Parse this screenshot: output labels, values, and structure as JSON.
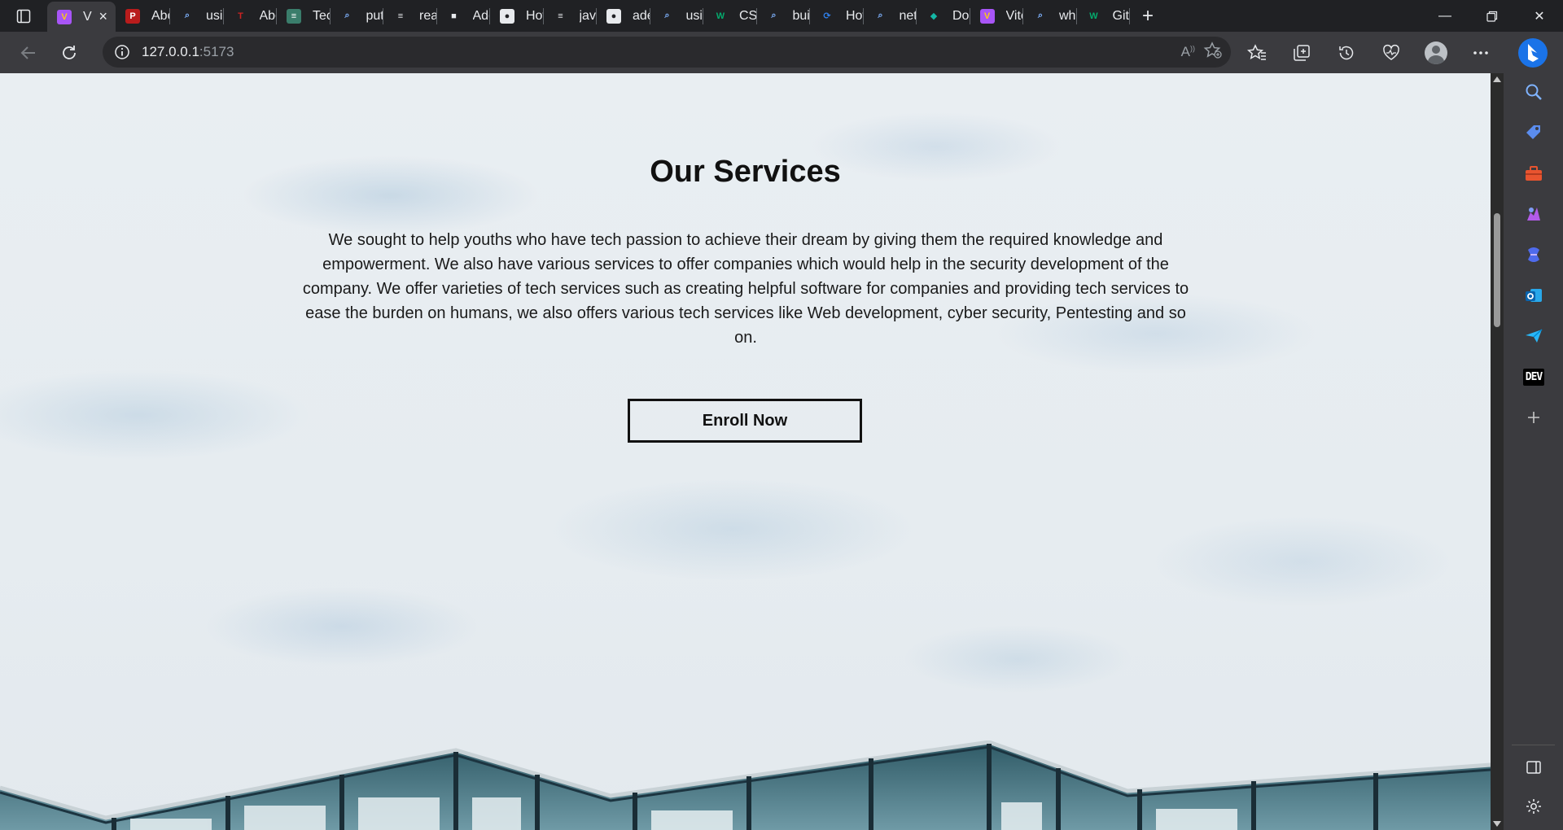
{
  "tabs": [
    {
      "title": "V",
      "favicon": "vite-icon",
      "active": true
    },
    {
      "title": "Abou",
      "favicon": "pdf-icon"
    },
    {
      "title": "using",
      "favicon": "search-icon"
    },
    {
      "title": "Abou",
      "favicon": "tesla-icon"
    },
    {
      "title": "Tech",
      "favicon": "doc-icon"
    },
    {
      "title": "puttir",
      "favicon": "search-icon"
    },
    {
      "title": "react",
      "favicon": "stack-icon"
    },
    {
      "title": "Add",
      "favicon": "video-icon"
    },
    {
      "title": "How",
      "favicon": "record-icon"
    },
    {
      "title": "javas",
      "favicon": "stack-icon"
    },
    {
      "title": "adeb",
      "favicon": "github-icon"
    },
    {
      "title": "using",
      "favicon": "search-icon"
    },
    {
      "title": "CSS",
      "favicon": "w3-icon"
    },
    {
      "title": "build",
      "favicon": "search-icon"
    },
    {
      "title": "How",
      "favicon": "swirl-icon"
    },
    {
      "title": "netlif",
      "favicon": "search-icon"
    },
    {
      "title": "Dom",
      "favicon": "diamond-icon"
    },
    {
      "title": "Vite",
      "favicon": "vite-icon"
    },
    {
      "title": "what",
      "favicon": "search-icon"
    },
    {
      "title": "Git C",
      "favicon": "w3-icon"
    }
  ],
  "address": {
    "host": "127.0.0.1",
    "port": ":5173"
  },
  "page": {
    "title": "Our Services",
    "description": "We sought to help youths who have tech passion to achieve their dream by giving them the required knowledge and empowerment. We also have various services to offer companies which would help in the security development of the company. We offer varieties of tech services such as creating helpful software for companies and providing tech services to ease the burden on humans, we also offers various tech services like Web development, cyber security, Pentesting and so on.",
    "cta_label": "Enroll Now"
  },
  "sidebar": {
    "items": [
      "search-icon",
      "tag-icon",
      "toolbox-icon",
      "games-icon",
      "copilot-icon",
      "outlook-icon",
      "send-icon",
      "dev-icon",
      "add-icon"
    ],
    "dev_label": "DEV"
  },
  "colors": {
    "chrome_dark": "#202124",
    "chrome_bar": "#3b3b3f",
    "page_bg": "#e8edf1",
    "text": "#111111"
  }
}
